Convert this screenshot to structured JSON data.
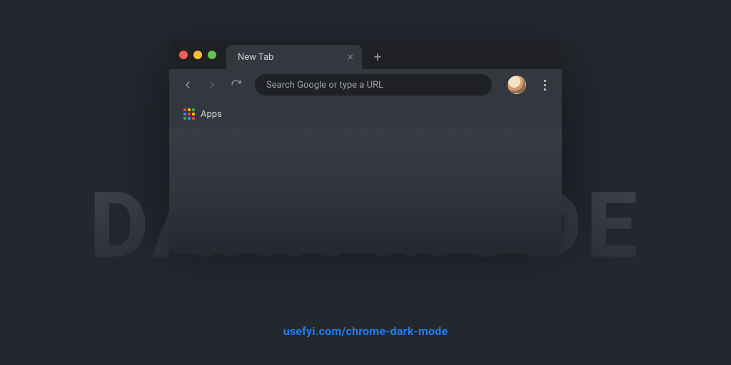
{
  "tab": {
    "title": "New Tab"
  },
  "omnibox": {
    "placeholder": "Search Google or type a URL",
    "value": ""
  },
  "bookmarks": {
    "apps_label": "Apps"
  },
  "headline": "DARK MODE",
  "link": {
    "text": "usefyi.com/chrome-dark-mode",
    "href": "#"
  },
  "traffic": {
    "close": "#ed5f56",
    "min": "#f6bd3b",
    "max": "#61c555"
  },
  "accent": "#1f7df0"
}
